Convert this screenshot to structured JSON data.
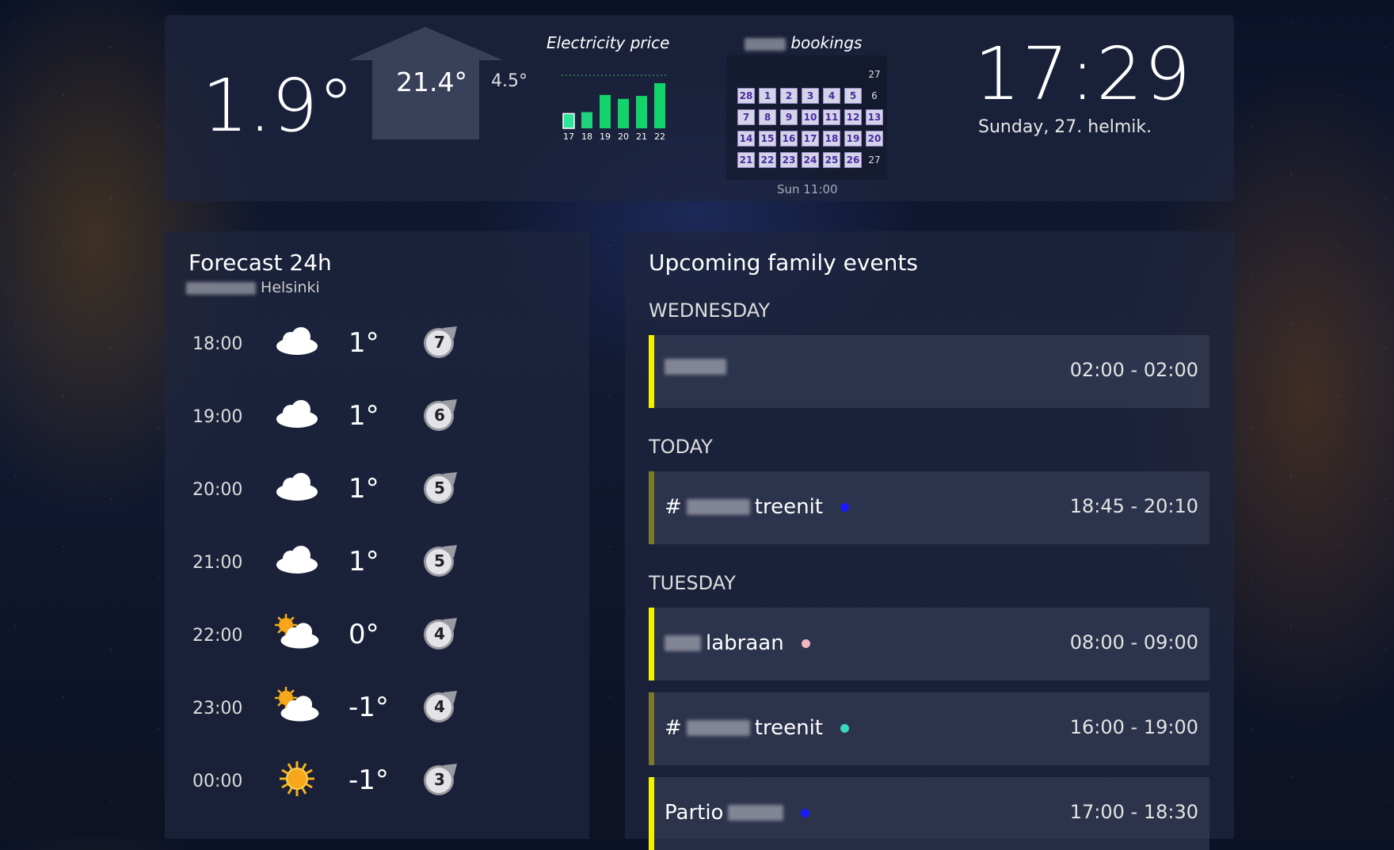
{
  "header": {
    "outdoor_temp": "1.9°",
    "indoor_temp": "21.4°",
    "aux_temp": "4.5°",
    "clock": "17:29",
    "date": "Sunday, 27. helmik."
  },
  "electricity": {
    "title": "Electricity price",
    "hours": [
      "17",
      "18",
      "19",
      "20",
      "21",
      "22"
    ],
    "levels": [
      0.3,
      0.33,
      0.68,
      0.6,
      0.66,
      0.92
    ],
    "colors": [
      "#2ee39a",
      "#1ed37c",
      "#12d46a",
      "#12d46a",
      "#12d46a",
      "#12d46a"
    ]
  },
  "bookings": {
    "title": "bookings",
    "footer": "Sun 11:00",
    "rows": [
      [
        {
          "d": "",
          "b": false
        },
        {
          "d": "",
          "b": false
        },
        {
          "d": "",
          "b": false
        },
        {
          "d": "",
          "b": false
        },
        {
          "d": "",
          "b": false
        },
        {
          "d": "",
          "b": false
        },
        {
          "d": "27",
          "b": false
        }
      ],
      [
        {
          "d": "28",
          "b": true
        },
        {
          "d": "1",
          "b": true
        },
        {
          "d": "2",
          "b": true
        },
        {
          "d": "3",
          "b": true
        },
        {
          "d": "4",
          "b": true
        },
        {
          "d": "5",
          "b": true
        },
        {
          "d": "6",
          "b": false
        }
      ],
      [
        {
          "d": "7",
          "b": true
        },
        {
          "d": "8",
          "b": true
        },
        {
          "d": "9",
          "b": true
        },
        {
          "d": "10",
          "b": true
        },
        {
          "d": "11",
          "b": true
        },
        {
          "d": "12",
          "b": true
        },
        {
          "d": "13",
          "b": true
        }
      ],
      [
        {
          "d": "14",
          "b": true
        },
        {
          "d": "15",
          "b": true
        },
        {
          "d": "16",
          "b": true
        },
        {
          "d": "17",
          "b": true
        },
        {
          "d": "18",
          "b": true
        },
        {
          "d": "19",
          "b": true
        },
        {
          "d": "20",
          "b": true
        }
      ],
      [
        {
          "d": "21",
          "b": true
        },
        {
          "d": "22",
          "b": true
        },
        {
          "d": "23",
          "b": true
        },
        {
          "d": "24",
          "b": true
        },
        {
          "d": "25",
          "b": true
        },
        {
          "d": "26",
          "b": true
        },
        {
          "d": "27",
          "b": false
        }
      ]
    ]
  },
  "forecast": {
    "title": "Forecast 24h",
    "location": "Helsinki",
    "rows": [
      {
        "time": "18:00",
        "icon": "cloud-icon",
        "temp": "1°",
        "wind": "7"
      },
      {
        "time": "19:00",
        "icon": "cloud-icon",
        "temp": "1°",
        "wind": "6"
      },
      {
        "time": "20:00",
        "icon": "cloud-icon",
        "temp": "1°",
        "wind": "5"
      },
      {
        "time": "21:00",
        "icon": "cloud-icon",
        "temp": "1°",
        "wind": "5"
      },
      {
        "time": "22:00",
        "icon": "partly-cloudy-icon",
        "temp": "0°",
        "wind": "4"
      },
      {
        "time": "23:00",
        "icon": "partly-cloudy-icon",
        "temp": "-1°",
        "wind": "4"
      },
      {
        "time": "00:00",
        "icon": "sun-icon",
        "temp": "-1°",
        "wind": "3"
      }
    ]
  },
  "events": {
    "title": "Upcoming family events",
    "days": [
      {
        "label": "WEDNESDAY",
        "items": [
          {
            "name": "",
            "time": "02:00 - 02:00",
            "bar": "#f2f200",
            "dot": ""
          }
        ]
      },
      {
        "label": "TODAY",
        "items": [
          {
            "name": "treenit",
            "prefix": "#",
            "time": "18:45 - 20:10",
            "bar": "#7a7a2a",
            "dot": "#1a1aff"
          }
        ]
      },
      {
        "label": "TUESDAY",
        "items": [
          {
            "name": "labraan",
            "prefix": "",
            "time": "08:00 - 09:00",
            "bar": "#f2f200",
            "dot": "#f4b6c2"
          },
          {
            "name": "treenit",
            "prefix": "#",
            "time": "16:00 - 19:00",
            "bar": "#7a7a2a",
            "dot": "#3ad6c0"
          },
          {
            "name": "Partio",
            "prefix": "",
            "time": "17:00 - 18:30",
            "bar": "#f2f200",
            "dot": "#1a1aff"
          }
        ]
      }
    ]
  }
}
